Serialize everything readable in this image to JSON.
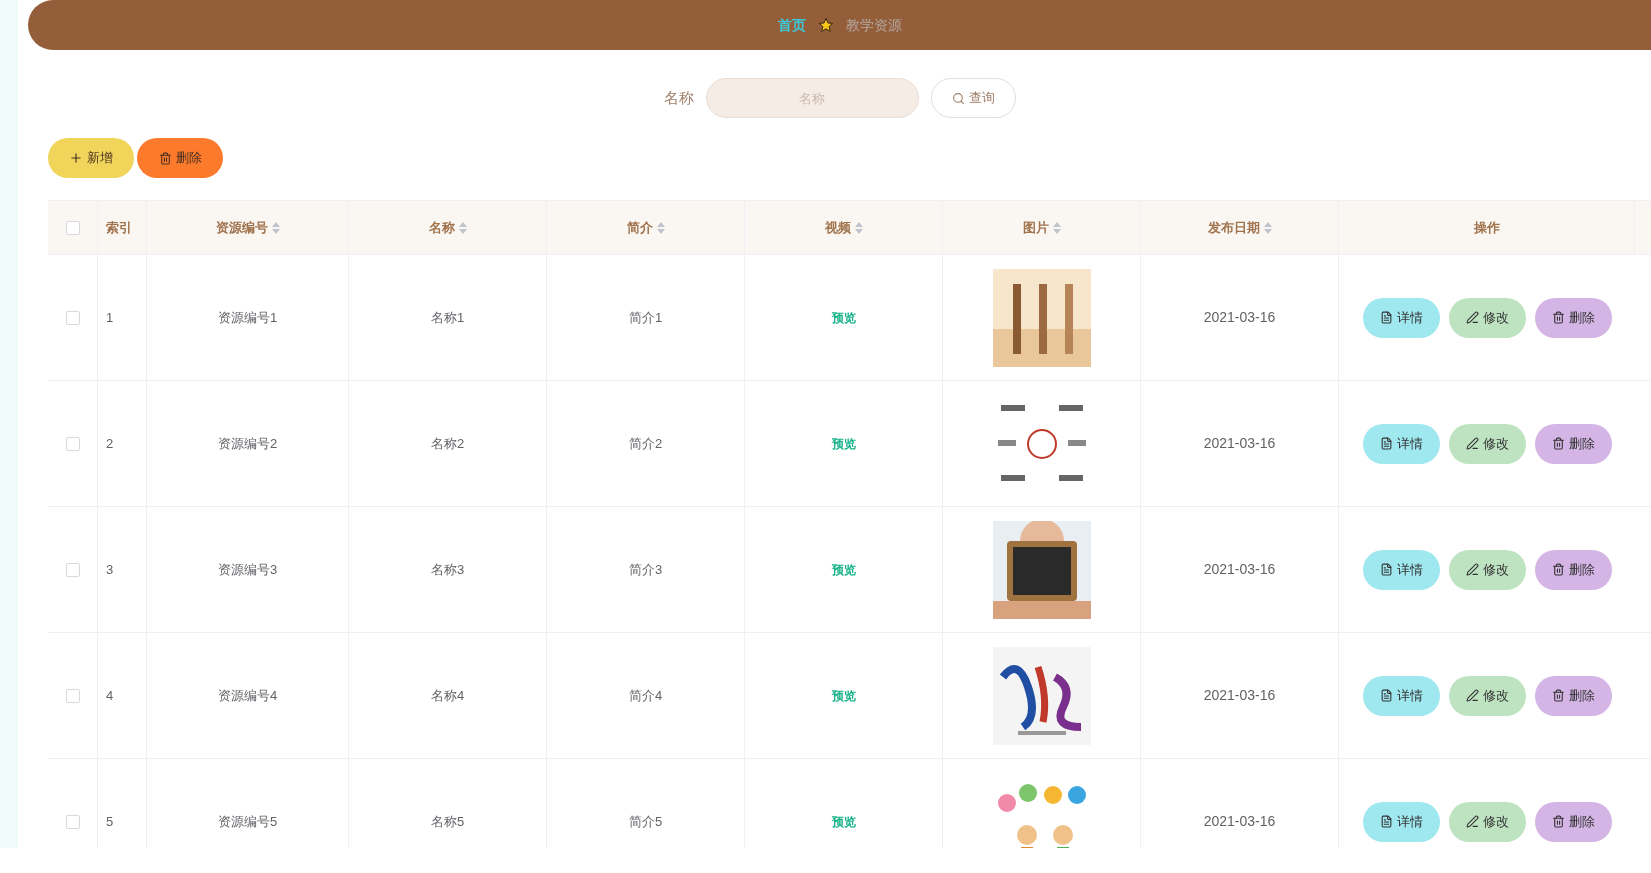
{
  "breadcrumb": [
    {
      "label": "首页",
      "selected": true
    },
    {
      "label": "教学资源",
      "selected": false
    }
  ],
  "search": {
    "label": "名称",
    "placeholder": "名称",
    "button": "查询"
  },
  "actions": [
    {
      "label": "新增",
      "kind": "add"
    },
    {
      "label": "删除",
      "kind": "delete"
    }
  ],
  "table": {
    "select_all": {
      "checked": false
    },
    "columns": [
      {
        "label": "索引",
        "sortable": false
      },
      {
        "label": "资源编号",
        "sortable": true
      },
      {
        "label": "名称",
        "sortable": true
      },
      {
        "label": "简介",
        "sortable": true
      },
      {
        "label": "视频",
        "sortable": true
      },
      {
        "label": "图片",
        "sortable": true
      },
      {
        "label": "发布日期",
        "sortable": true
      },
      {
        "label": "操作",
        "sortable": false
      }
    ],
    "rows": [
      {
        "checked": false,
        "index": "1",
        "code": "资源编号1",
        "name": "名称1",
        "intro": "简介1",
        "video": "预览",
        "date": "2021-03-16",
        "buttons": [
          {
            "label": "详情",
            "kind": "detail"
          },
          {
            "label": "修改",
            "kind": "edit"
          },
          {
            "label": "删除",
            "kind": "delete"
          }
        ]
      },
      {
        "checked": false,
        "index": "2",
        "code": "资源编号2",
        "name": "名称2",
        "intro": "简介2",
        "video": "预览",
        "date": "2021-03-16",
        "buttons": [
          {
            "label": "详情",
            "kind": "detail"
          },
          {
            "label": "修改",
            "kind": "edit"
          },
          {
            "label": "删除",
            "kind": "delete"
          }
        ]
      },
      {
        "checked": false,
        "index": "3",
        "code": "资源编号3",
        "name": "名称3",
        "intro": "简介3",
        "video": "预览",
        "date": "2021-03-16",
        "buttons": [
          {
            "label": "详情",
            "kind": "detail"
          },
          {
            "label": "修改",
            "kind": "edit"
          },
          {
            "label": "删除",
            "kind": "delete"
          }
        ]
      },
      {
        "checked": false,
        "index": "4",
        "code": "资源编号4",
        "name": "名称4",
        "intro": "简介4",
        "video": "预览",
        "date": "2021-03-16",
        "buttons": [
          {
            "label": "详情",
            "kind": "detail"
          },
          {
            "label": "修改",
            "kind": "edit"
          },
          {
            "label": "删除",
            "kind": "delete"
          }
        ]
      },
      {
        "checked": false,
        "index": "5",
        "code": "资源编号5",
        "name": "名称5",
        "intro": "简介5",
        "video": "预览",
        "date": "2021-03-16",
        "buttons": [
          {
            "label": "详情",
            "kind": "detail"
          },
          {
            "label": "修改",
            "kind": "edit"
          },
          {
            "label": "删除",
            "kind": "delete"
          }
        ]
      }
    ]
  }
}
